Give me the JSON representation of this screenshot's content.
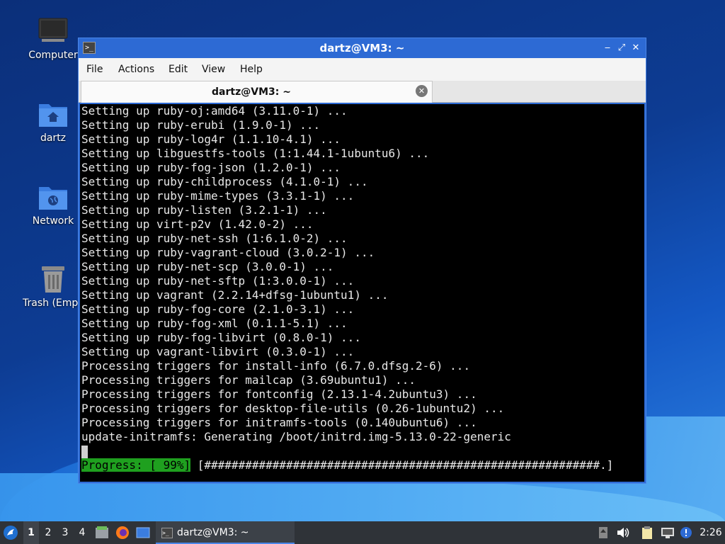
{
  "desktop": {
    "icons": [
      {
        "label": "Computer",
        "icon": "computer-icon"
      },
      {
        "label": "dartz",
        "icon": "home-folder-icon"
      },
      {
        "label": "Network",
        "icon": "network-folder-icon"
      },
      {
        "label": "Trash (Empty)",
        "icon": "trash-icon"
      }
    ]
  },
  "window": {
    "title": "dartz@VM3: ~",
    "controls": {
      "minimize": "‒",
      "maximize": "⤢",
      "close": "✕"
    },
    "menu": [
      "File",
      "Actions",
      "Edit",
      "View",
      "Help"
    ],
    "tab": {
      "label": "dartz@VM3: ~"
    },
    "terminal": {
      "lines": [
        "Setting up ruby-oj:amd64 (3.11.0-1) ...",
        "Setting up ruby-erubi (1.9.0-1) ...",
        "Setting up ruby-log4r (1.1.10-4.1) ...",
        "Setting up libguestfs-tools (1:1.44.1-1ubuntu6) ...",
        "Setting up ruby-fog-json (1.2.0-1) ...",
        "Setting up ruby-childprocess (4.1.0-1) ...",
        "Setting up ruby-mime-types (3.3.1-1) ...",
        "Setting up ruby-listen (3.2.1-1) ...",
        "Setting up virt-p2v (1.42.0-2) ...",
        "Setting up ruby-net-ssh (1:6.1.0-2) ...",
        "Setting up ruby-vagrant-cloud (3.0.2-1) ...",
        "Setting up ruby-net-scp (3.0.0-1) ...",
        "Setting up ruby-net-sftp (1:3.0.0-1) ...",
        "Setting up vagrant (2.2.14+dfsg-1ubuntu1) ...",
        "Setting up ruby-fog-core (2.1.0-3.1) ...",
        "Setting up ruby-fog-xml (0.1.1-5.1) ...",
        "Setting up ruby-fog-libvirt (0.8.0-1) ...",
        "Setting up vagrant-libvirt (0.3.0-1) ...",
        "Processing triggers for install-info (6.7.0.dfsg.2-6) ...",
        "Processing triggers for mailcap (3.69ubuntu1) ...",
        "Processing triggers for fontconfig (2.13.1-4.2ubuntu3) ...",
        "Processing triggers for desktop-file-utils (0.26-1ubuntu2) ...",
        "Processing triggers for initramfs-tools (0.140ubuntu6) ...",
        "update-initramfs: Generating /boot/initrd.img-5.13.0-22-generic"
      ],
      "progress_label": "Progress: [ 99%]",
      "progress_bar": "[##########################################################.]",
      "progress_percent": 99
    }
  },
  "taskbar": {
    "workspaces": [
      "1",
      "2",
      "3",
      "4"
    ],
    "active_workspace": "1",
    "task_label": "dartz@VM3: ~",
    "clock": "2:26"
  },
  "colors": {
    "progress_green": "#1fa01f",
    "titlebar": "#2d6ad4",
    "taskbar": "#2f3338"
  }
}
